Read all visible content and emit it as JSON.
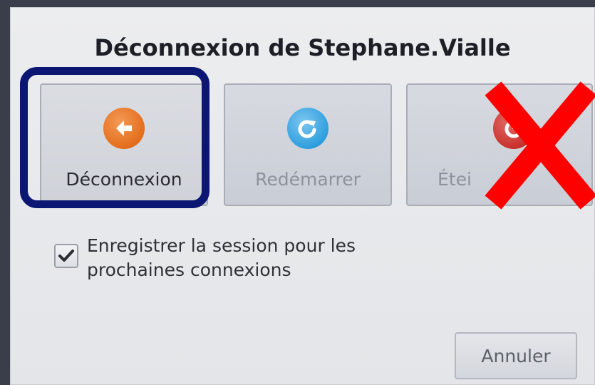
{
  "dialog": {
    "title": "Déconnexion de Stephane.Vialle"
  },
  "actions": [
    {
      "label": "Déconnexion",
      "icon": "arrow-left-icon",
      "color": "#e46d1c",
      "enabled": true
    },
    {
      "label": "Redémarrer",
      "icon": "restart-icon",
      "color": "#2f9fde",
      "enabled": false
    },
    {
      "label": "Étei",
      "icon": "power-icon",
      "color": "#c9312d",
      "enabled": false
    }
  ],
  "save_session": {
    "label_line1": "Enregistrer la session pour les",
    "label_line2": "prochaines connexions",
    "checked": true
  },
  "cancel": {
    "label": "Annuler"
  },
  "annotations": {
    "highlight_color": "#0b1773",
    "cross_color": "#ff0000"
  }
}
